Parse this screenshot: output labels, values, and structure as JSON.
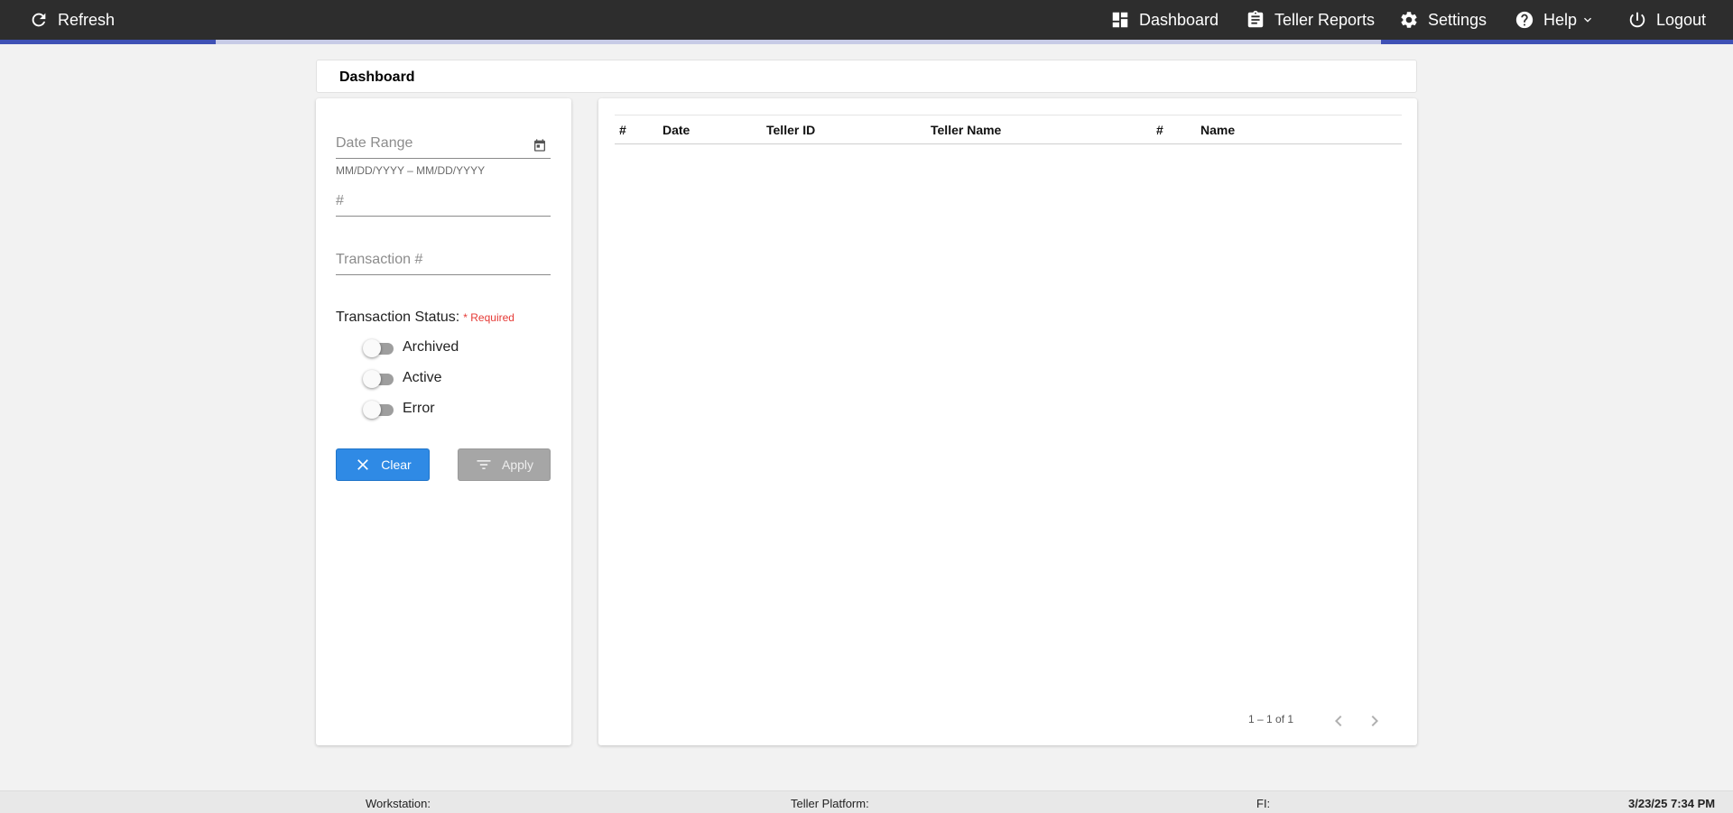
{
  "topbar": {
    "refresh_label": "Refresh",
    "dashboard_label": "Dashboard",
    "teller_reports_label": "Teller Reports",
    "settings_label": "Settings",
    "help_label": "Help",
    "logout_label": "Logout"
  },
  "page": {
    "title": "Dashboard"
  },
  "filters": {
    "date_range_placeholder": "Date Range",
    "date_range_hint": "MM/DD/YYYY – MM/DD/YYYY",
    "number_placeholder": "#",
    "transaction_placeholder": "Transaction #",
    "status_label": "Transaction Status:",
    "status_required": "* Required",
    "statuses": [
      {
        "label": "Archived",
        "on": false
      },
      {
        "label": "Active",
        "on": false
      },
      {
        "label": "Error",
        "on": false
      }
    ],
    "clear_label": "Clear",
    "apply_label": "Apply"
  },
  "table": {
    "columns": [
      "#",
      "Date",
      "Teller ID",
      "Teller Name",
      "#",
      "Name"
    ],
    "rows": [],
    "range_label": "1 – 1 of 1"
  },
  "footer": {
    "workstation_label": "Workstation:",
    "platform_label": "Teller Platform:",
    "fi_label": "FI:",
    "datetime": "3/23/25 7:34 PM"
  },
  "colors": {
    "accent": "#3f51b5",
    "clear_button": "#2f8ae5",
    "required": "#e53935"
  }
}
